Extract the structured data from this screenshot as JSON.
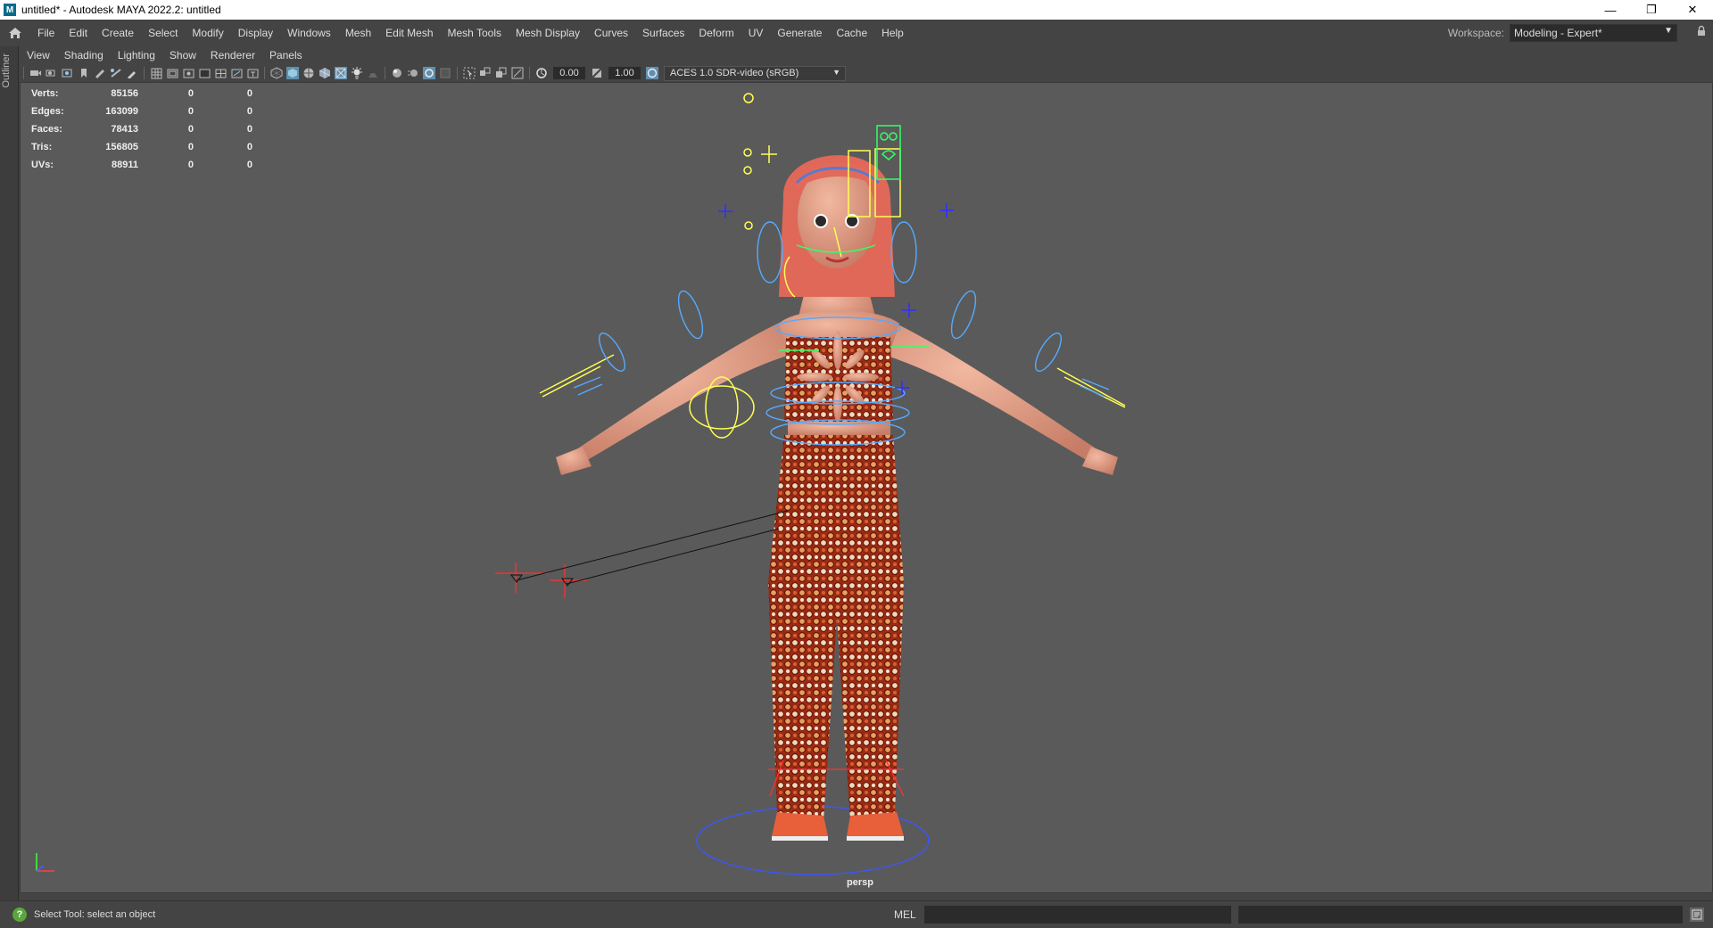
{
  "window": {
    "title": "untitled* - Autodesk MAYA 2022.2: untitled",
    "app_icon": "M",
    "controls": [
      "minimize-icon",
      "restore-icon",
      "close-icon"
    ]
  },
  "menubar": {
    "items": [
      "File",
      "Edit",
      "Create",
      "Select",
      "Modify",
      "Display",
      "Windows",
      "Mesh",
      "Edit Mesh",
      "Mesh Tools",
      "Mesh Display",
      "Curves",
      "Surfaces",
      "Deform",
      "UV",
      "Generate",
      "Cache",
      "Help"
    ],
    "workspace_label": "Workspace:",
    "workspace_value": "Modeling - Expert*"
  },
  "outliner": {
    "label": "Outliner"
  },
  "panel_menu": {
    "items": [
      "View",
      "Shading",
      "Lighting",
      "Show",
      "Renderer",
      "Panels"
    ]
  },
  "toolbar": {
    "exposure": "0.00",
    "gamma": "1.00",
    "color_space": "ACES 1.0 SDR-video (sRGB)"
  },
  "hud": {
    "rows": [
      {
        "label": "Verts:",
        "v1": "85156",
        "v2": "0",
        "v3": "0"
      },
      {
        "label": "Edges:",
        "v1": "163099",
        "v2": "0",
        "v3": "0"
      },
      {
        "label": "Faces:",
        "v1": "78413",
        "v2": "0",
        "v3": "0"
      },
      {
        "label": "Tris:",
        "v1": "156805",
        "v2": "0",
        "v3": "0"
      },
      {
        "label": "UVs:",
        "v1": "88911",
        "v2": "0",
        "v3": "0"
      }
    ]
  },
  "viewport": {
    "camera": "persp"
  },
  "statusbar": {
    "help_text": "Select Tool: select an object",
    "mel_label": "MEL"
  },
  "colors": {
    "viewport_bg": "#5a5a5a",
    "control_yellow": "#ffff55",
    "control_blue": "#55aaff",
    "control_red": "#ff3030",
    "dress_red": "#b0301a"
  }
}
